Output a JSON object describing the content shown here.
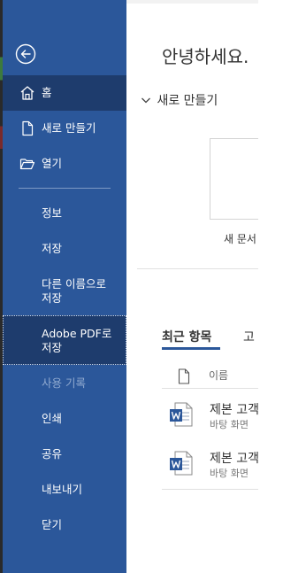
{
  "sidebar": {
    "back_label": "뒤로",
    "items": [
      {
        "label": "홈",
        "icon": "home-icon",
        "state": "active"
      },
      {
        "label": "새로 만들기",
        "icon": "new-document-icon",
        "state": "normal"
      },
      {
        "label": "열기",
        "icon": "open-folder-icon",
        "state": "normal"
      },
      {
        "label": "정보",
        "state": "normal"
      },
      {
        "label": "저장",
        "state": "normal"
      },
      {
        "label": "다른 이름으로\n저장",
        "state": "normal"
      },
      {
        "label": "Adobe PDF로\n저장",
        "state": "selected"
      },
      {
        "label": "사용 기록",
        "state": "disabled"
      },
      {
        "label": "인쇄",
        "state": "normal"
      },
      {
        "label": "공유",
        "state": "normal"
      },
      {
        "label": "내보내기",
        "state": "normal"
      },
      {
        "label": "닫기",
        "state": "normal"
      }
    ]
  },
  "main": {
    "greeting": "안녕하세요.",
    "new_section": {
      "title": "새로 만들기",
      "template_label": "새 문서"
    },
    "tabs": [
      {
        "label": "최근 항목",
        "active": true
      },
      {
        "label": "고",
        "active": false
      }
    ],
    "column_header": "이름",
    "recent_files": [
      {
        "name": "제본 고객",
        "location": "바탕 화면"
      },
      {
        "name": "제본 고객",
        "location": "바탕 화면"
      }
    ]
  },
  "colors": {
    "sidebar_bg": "#2b579a",
    "sidebar_active": "#1e3c6d",
    "word_blue": "#2b579a"
  }
}
